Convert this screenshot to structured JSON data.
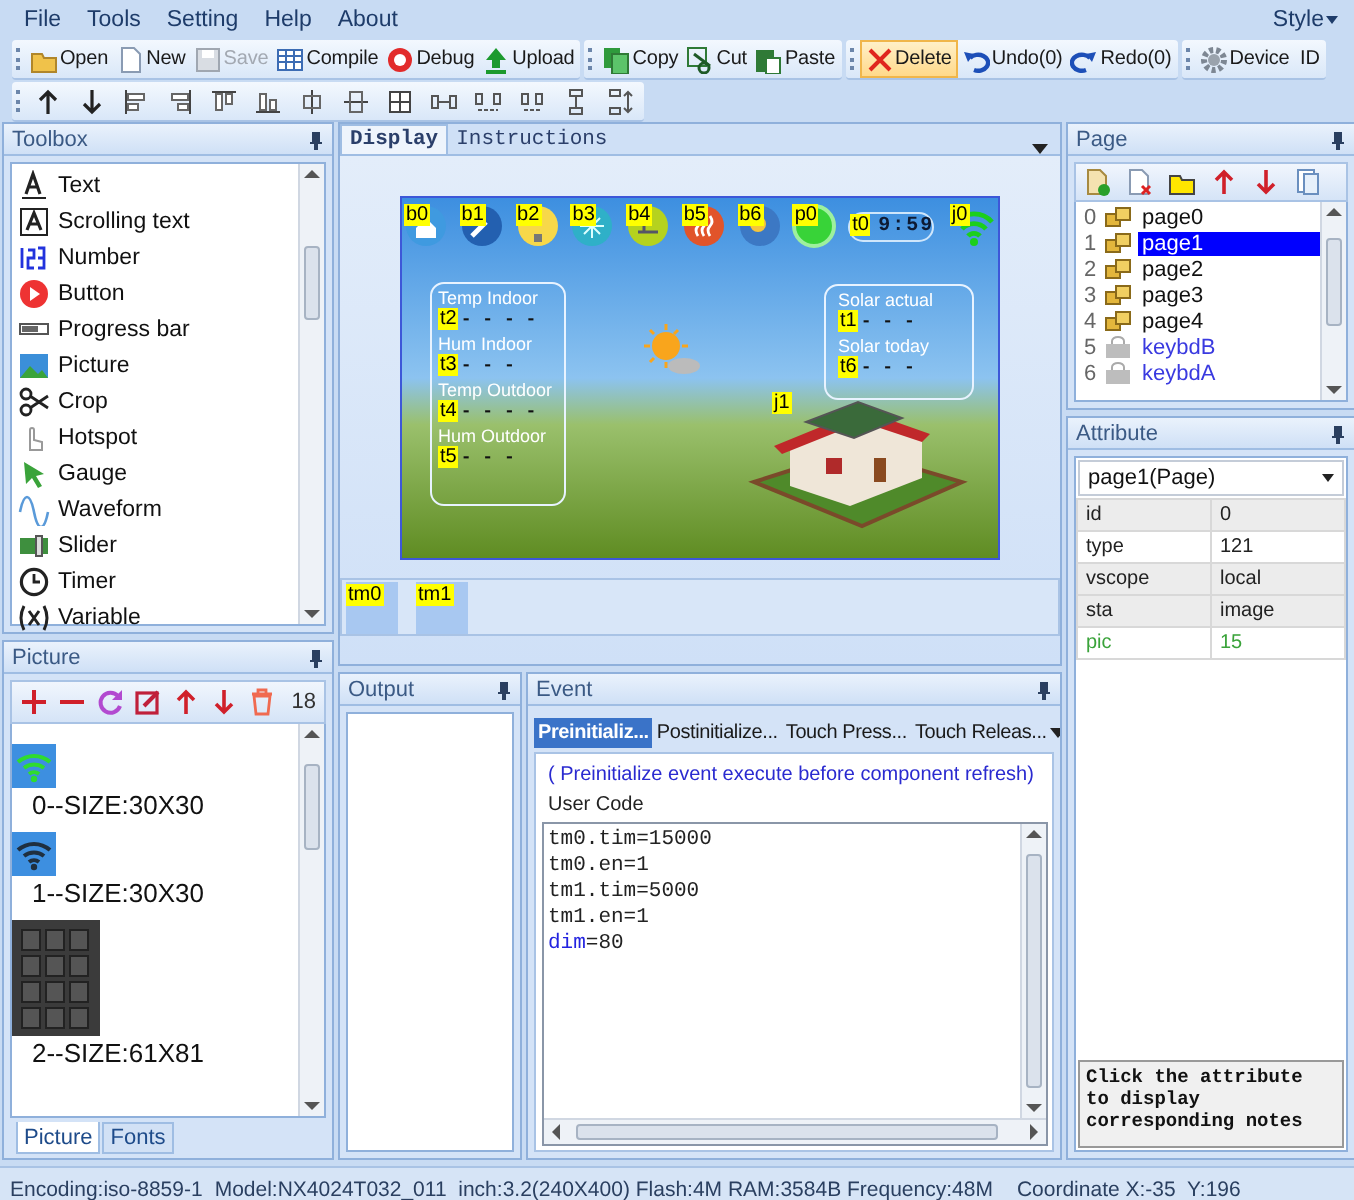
{
  "menu": [
    {
      "label": "File"
    },
    {
      "label": "Tools"
    },
    {
      "label": "Setting"
    },
    {
      "label": "Help"
    },
    {
      "label": "About"
    }
  ],
  "style_menu": {
    "label": "Style"
  },
  "toolbar": [
    [
      {
        "label": "Open",
        "kind": "open",
        "disabled": false,
        "highlighted": false
      },
      {
        "label": "New",
        "kind": "new",
        "disabled": false,
        "highlighted": false
      },
      {
        "label": "Save",
        "kind": "save",
        "disabled": true,
        "highlighted": false
      },
      {
        "label": "Compile",
        "kind": "compile",
        "disabled": false,
        "highlighted": false
      },
      {
        "label": "Debug",
        "kind": "debug",
        "disabled": false,
        "highlighted": false
      },
      {
        "label": "Upload",
        "kind": "upload",
        "disabled": false,
        "highlighted": false
      }
    ],
    [
      {
        "label": "Copy",
        "kind": "copy",
        "disabled": false,
        "highlighted": false
      },
      {
        "label": "Cut",
        "kind": "cut",
        "disabled": false,
        "highlighted": false
      },
      {
        "label": "Paste",
        "kind": "paste",
        "disabled": false,
        "highlighted": false
      }
    ],
    [
      {
        "label": "Delete",
        "kind": "delete",
        "disabled": false,
        "highlighted": true
      },
      {
        "label": "Undo(0)",
        "kind": "undo",
        "disabled": false,
        "highlighted": false
      },
      {
        "label": "Redo(0)",
        "kind": "redo",
        "disabled": false,
        "highlighted": false
      }
    ],
    [
      {
        "label": "Device  ID",
        "kind": "device",
        "disabled": false,
        "highlighted": false
      }
    ]
  ],
  "toolbox": {
    "title": "Toolbox",
    "items": [
      {
        "label": "Text",
        "kind": "text"
      },
      {
        "label": "Scrolling text",
        "kind": "scrolling"
      },
      {
        "label": "Number",
        "kind": "number"
      },
      {
        "label": "Button",
        "kind": "button"
      },
      {
        "label": "Progress bar",
        "kind": "progress"
      },
      {
        "label": "Picture",
        "kind": "picture"
      },
      {
        "label": "Crop",
        "kind": "crop"
      },
      {
        "label": "Hotspot",
        "kind": "hotspot"
      },
      {
        "label": "Gauge",
        "kind": "gauge"
      },
      {
        "label": "Waveform",
        "kind": "waveform"
      },
      {
        "label": "Slider",
        "kind": "slider"
      },
      {
        "label": "Timer",
        "kind": "timer"
      },
      {
        "label": "Variable",
        "kind": "variable"
      }
    ]
  },
  "picture": {
    "title": "Picture",
    "count": "18",
    "items": [
      {
        "caption": "0--SIZE:30X30",
        "kind": "wifi-green"
      },
      {
        "caption": "1--SIZE:30X30",
        "kind": "wifi-dark"
      },
      {
        "caption": "2--SIZE:61X81",
        "kind": "keypad"
      }
    ],
    "tabs": [
      {
        "label": "Picture",
        "selected": true
      },
      {
        "label": "Fonts",
        "selected": false
      }
    ]
  },
  "display": {
    "tabs": [
      {
        "label": "Display",
        "selected": true
      },
      {
        "label": "Instructions",
        "selected": false
      }
    ],
    "top_components": [
      {
        "tag": "b0",
        "kind": "home"
      },
      {
        "tag": "b1",
        "kind": "tools"
      },
      {
        "tag": "b2",
        "kind": "bulb"
      },
      {
        "tag": "b3",
        "kind": "fan"
      },
      {
        "tag": "b4",
        "kind": "bike"
      },
      {
        "tag": "b5",
        "kind": "heat"
      },
      {
        "tag": "b6",
        "kind": "weather"
      },
      {
        "tag": "p0",
        "kind": "light"
      },
      {
        "tag": "t0",
        "kind": "clock",
        "text": "9:59"
      },
      {
        "tag": "j0",
        "kind": "wifi"
      }
    ],
    "left_fields": [
      {
        "label": "Temp Indoor",
        "tag": "t2",
        "value": "- - - -"
      },
      {
        "label": "Hum Indoor",
        "tag": "t3",
        "value": "- - -"
      },
      {
        "label": "Temp Outdoor",
        "tag": "t4",
        "value": "- - - -"
      },
      {
        "label": "Hum Outdoor",
        "tag": "t5",
        "value": "- - -"
      }
    ],
    "right_fields": [
      {
        "label": "Solar actual",
        "tag": "t1",
        "value": "- - -"
      },
      {
        "label": "Solar today",
        "tag": "t6",
        "value": "- - -"
      }
    ],
    "house_tag": "j1",
    "timers": [
      {
        "tag": "tm0"
      },
      {
        "tag": "tm1"
      }
    ]
  },
  "output": {
    "title": "Output"
  },
  "event": {
    "title": "Event",
    "tabs": [
      {
        "label": "Preinitializ...",
        "selected": true
      },
      {
        "label": "Postinitialize...",
        "selected": false
      },
      {
        "label": "Touch Press...",
        "selected": false
      },
      {
        "label": "Touch Releas...",
        "selected": false
      }
    ],
    "hint": "( Preinitialize event execute before component refresh)",
    "code_label": "User Code",
    "code": [
      [
        {
          "text": "tm0.tim=15000",
          "kind": "plain"
        }
      ],
      [
        {
          "text": "tm0.en=1",
          "kind": "plain"
        }
      ],
      [
        {
          "text": "tm1.tim=5000",
          "kind": "plain"
        }
      ],
      [
        {
          "text": "tm1.en=1",
          "kind": "plain"
        }
      ],
      [
        {
          "text": "dim",
          "kind": "keyword"
        },
        {
          "text": "=80",
          "kind": "plain"
        }
      ]
    ]
  },
  "page": {
    "title": "Page",
    "items": [
      {
        "index": "0",
        "label": "page0",
        "locked": false,
        "selected": false
      },
      {
        "index": "1",
        "label": "page1",
        "locked": false,
        "selected": true
      },
      {
        "index": "2",
        "label": "page2",
        "locked": false,
        "selected": false
      },
      {
        "index": "3",
        "label": "page3",
        "locked": false,
        "selected": false
      },
      {
        "index": "4",
        "label": "page4",
        "locked": false,
        "selected": false
      },
      {
        "index": "5",
        "label": "keybdB",
        "locked": true,
        "selected": false
      },
      {
        "index": "6",
        "label": "keybdA",
        "locked": true,
        "selected": false
      }
    ]
  },
  "attribute": {
    "title": "Attribute",
    "object": "page1(Page)",
    "rows": [
      {
        "name": "id",
        "value": "0",
        "shaded": true,
        "modified": false
      },
      {
        "name": "type",
        "value": "121",
        "shaded": false,
        "modified": false
      },
      {
        "name": "vscope",
        "value": "local",
        "shaded": true,
        "modified": false
      },
      {
        "name": "sta",
        "value": "image",
        "shaded": true,
        "modified": false
      },
      {
        "name": "pic",
        "value": "15",
        "shaded": false,
        "modified": true
      }
    ],
    "notes": "Click the attribute to display corresponding notes"
  },
  "status_bar": [
    "Encoding:iso-8859-1",
    "Model:NX4024T032_011  inch:3.2(240X400) Flash:4M RAM:3584B Frequency:48M",
    "Coordinate X:-35  Y:196"
  ]
}
